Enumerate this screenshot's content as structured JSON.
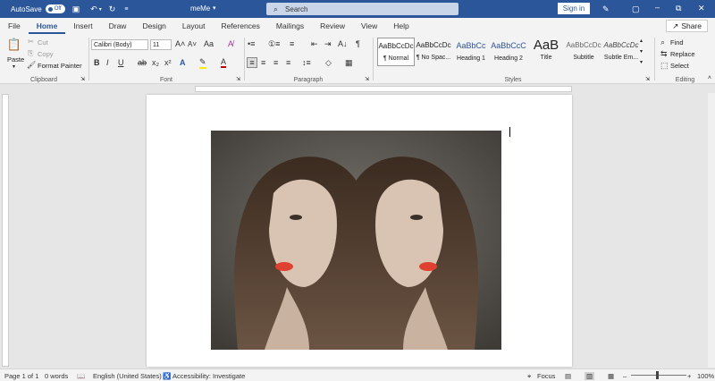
{
  "titlebar": {
    "autosave_label": "AutoSave",
    "autosave_state": "Off",
    "doc_title": "meMe",
    "search_placeholder": "Search",
    "signin_label": "Sign in"
  },
  "tabs": [
    "File",
    "Home",
    "Insert",
    "Draw",
    "Design",
    "Layout",
    "References",
    "Mailings",
    "Review",
    "View",
    "Help"
  ],
  "active_tab": "Home",
  "share_label": "Share",
  "clipboard": {
    "paste": "Paste",
    "cut": "Cut",
    "copy": "Copy",
    "format_painter": "Format Painter",
    "label": "Clipboard"
  },
  "font": {
    "name": "Calibri (Body)",
    "size": "11",
    "label": "Font"
  },
  "paragraph": {
    "label": "Paragraph"
  },
  "styles": {
    "label": "Styles",
    "items": [
      {
        "preview": "AaBbCcDc",
        "name": "¶ Normal"
      },
      {
        "preview": "AaBbCcDc",
        "name": "¶ No Spac..."
      },
      {
        "preview": "AaBbCc",
        "name": "Heading 1"
      },
      {
        "preview": "AaBbCcC",
        "name": "Heading 2"
      },
      {
        "preview": "AaB",
        "name": "Title"
      },
      {
        "preview": "AaBbCcDc",
        "name": "Subtitle"
      },
      {
        "preview": "AaBbCcDc",
        "name": "Subtle Em..."
      }
    ]
  },
  "editing": {
    "find": "Find",
    "replace": "Replace",
    "select": "Select",
    "label": "Editing"
  },
  "status": {
    "page": "Page 1 of 1",
    "words": "0 words",
    "language": "English (United States)",
    "accessibility": "Accessibility: Investigate",
    "focus": "Focus",
    "zoom": "100%"
  },
  "colors": {
    "brand": "#2b579a",
    "ribbon": "#f3f3f3"
  }
}
